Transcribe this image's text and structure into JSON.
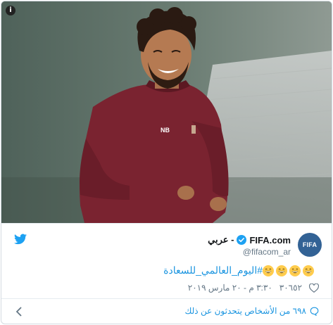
{
  "media": {
    "info_glyph": "i",
    "colors": {
      "background": "#56675f",
      "kit": "#7a2330"
    }
  },
  "header": {
    "display_name_ar": "عربي -",
    "display_name_en": "FIFA.com",
    "handle": "@fifacom_ar",
    "avatar_text": "FIFA",
    "verified": true,
    "icons": [
      "twitter-bird-icon",
      "verified-badge-icon"
    ]
  },
  "tweet": {
    "hashtag": "#اليوم_العالمي_للسعادة",
    "emoji_count": 4
  },
  "meta": {
    "likes": "٣٠٦٥٢",
    "timestamp": "٣:٣٠ م - ٢٠ مارس ٢٠١٩"
  },
  "footer": {
    "discussion_text": "٦٩٨ من الأشخاص يتحدثون عن ذلك"
  },
  "colors": {
    "accent": "#1b95e0",
    "secondary_text": "#657786",
    "border": "#d4dbe1"
  }
}
